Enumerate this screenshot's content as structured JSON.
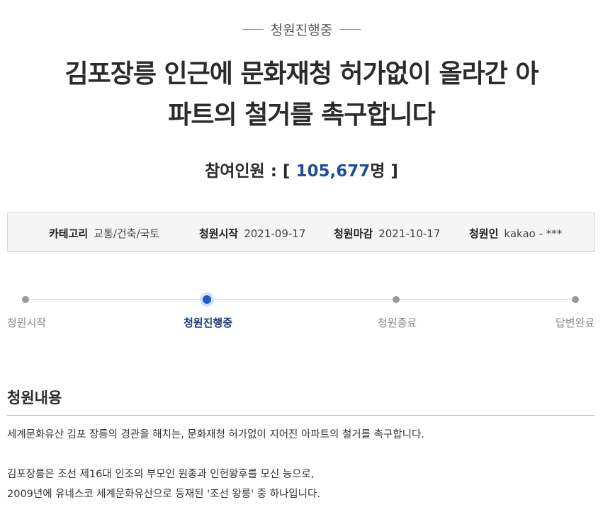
{
  "status_label": "청원진행중",
  "title_line1": "김포장릉 인근에 문화재청 허가없이 올라간 아",
  "title_line2": "파트의 철거를 촉구합니다",
  "participants": {
    "label": "참여인원 : [ ",
    "number": "105,677",
    "unit": "명 ]"
  },
  "info": {
    "category_key": "카테고리",
    "category_val": "교통/건축/국토",
    "start_key": "청원시작",
    "start_val": "2021-09-17",
    "end_key": "청원마감",
    "end_val": "2021-10-17",
    "author_key": "청원인",
    "author_val": "kakao - ***"
  },
  "steps": [
    "청원시작",
    "청원진행중",
    "청원종료",
    "답변완료"
  ],
  "active_step": 1,
  "section_title": "청원내용",
  "content": {
    "p1": "세계문화유산 김포 장릉의 경관을 해치는, 문화재청 허가없이 지어진 아파트의 철거를 촉구합니다.",
    "p2": "김포장릉은 조선 제16대 인조의 부모인 원종과 인헌왕후를 모신 능으로,",
    "p3": "2009년에 유네스코 세계문화유산으로 등재된 '조선 왕릉' 중 하나입니다."
  },
  "colors": {
    "accent": "#1b4f9c",
    "active_dot": "#1b5fc4"
  }
}
